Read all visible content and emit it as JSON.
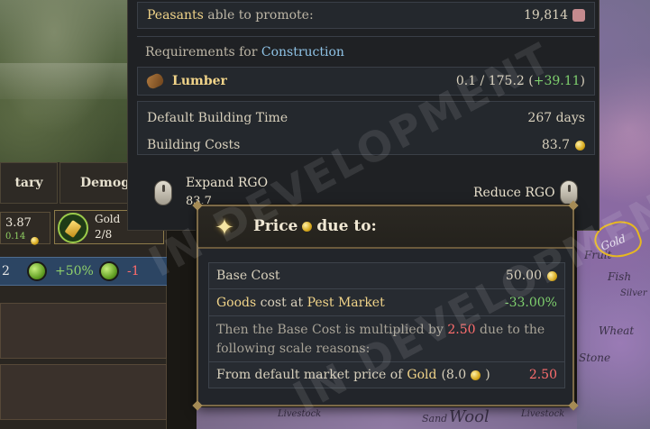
{
  "upper_panel": {
    "peasants_label": "Peasants",
    "peasants_suffix": "able to promote:",
    "peasants_value": "19,814",
    "requirements_prefix": "Requirements for",
    "requirements_target": "Construction",
    "lumber_label": "Lumber",
    "lumber_value": "0.1 / 175.2 (",
    "lumber_delta": "+39.11",
    "lumber_close": ")",
    "build_time_label": "Default Building Time",
    "build_time_value": "267 days",
    "build_cost_label": "Building Costs",
    "build_cost_value": "83.7",
    "expand_rgo_label": "Expand RGO",
    "expand_rgo_value": "83.7",
    "reduce_rgo_label": "Reduce RGO"
  },
  "left_panel": {
    "tab_1": "tary",
    "tab_2": "Demog",
    "stat_value": "3.87",
    "stat_small": "0.14",
    "good_name": "Gold",
    "good_count": "2/8",
    "row_value_1": "2",
    "row_pct": "+50%",
    "row_neg": "-1"
  },
  "tooltip": {
    "title_prefix": "Price",
    "title_suffix": "due to:",
    "base_cost_label": "Base Cost",
    "base_cost_value": "50.00",
    "goods_label": "Goods",
    "goods_mid": "cost at",
    "market_label": "Pest Market",
    "goods_value": "-33.00%",
    "scale_text_1": "Then the Base Cost is multiplied by",
    "scale_multiplier": "2.50",
    "scale_text_2": "due to the",
    "scale_text_3": "following scale reasons:",
    "default_price_prefix": "From default market price of",
    "default_price_good": "Gold",
    "default_price_open": "(8.0",
    "default_price_close": ")",
    "default_price_value": "2.50"
  },
  "map_labels": [
    "Fish",
    "Silver",
    "Wheat",
    "Stone",
    "Livestock",
    "Sand",
    "Wool",
    "Gold",
    "Fruit",
    "Livestock"
  ],
  "watermark": "IN DEVELOPMENT",
  "colors": {
    "gold_text": "#f1d489",
    "blue_text": "#8fc3e6",
    "green_text": "#7fd06e",
    "red_text": "#ff6e6e",
    "tooltip_border": "#7c6a48"
  }
}
